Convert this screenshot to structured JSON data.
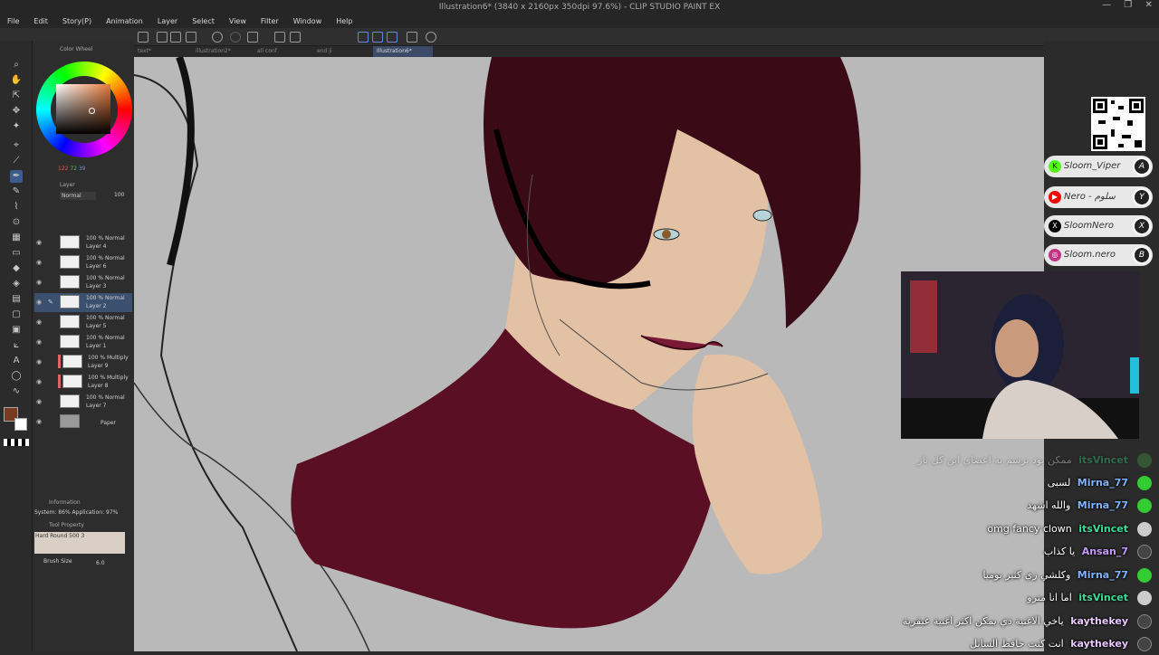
{
  "app": {
    "title": "Illustration6* (3840 x 2160px 350dpi 97.6%) - CLIP STUDIO PAINT EX",
    "window_controls": [
      "—",
      "❐",
      "✕"
    ]
  },
  "menu": [
    "File",
    "Edit",
    "Story(P)",
    "Animation",
    "Layer",
    "Select",
    "View",
    "Filter",
    "Window",
    "Help"
  ],
  "tabs": [
    {
      "label": "text*"
    },
    {
      "label": "illustration2*"
    },
    {
      "label": "all conf"
    },
    {
      "label": "end ji"
    },
    {
      "label": "Illustration6*",
      "active": true
    }
  ],
  "color_panel": {
    "title": "Color Wheel",
    "hsv": [
      "122",
      "72",
      "39"
    ],
    "accent": "#e8793a"
  },
  "layer_panel": {
    "title": "Layer",
    "opacity": "100",
    "blend_mode": "Normal",
    "layers": [
      {
        "mode": "100 % Normal",
        "name": "Layer 4",
        "selected": false
      },
      {
        "mode": "100 % Normal",
        "name": "Layer 6",
        "selected": false
      },
      {
        "mode": "100 % Normal",
        "name": "Layer 3",
        "selected": false
      },
      {
        "mode": "100 % Normal",
        "name": "Layer 2",
        "selected": true
      },
      {
        "mode": "100 % Normal",
        "name": "Layer 5",
        "selected": false
      },
      {
        "mode": "100 % Normal",
        "name": "Layer 1",
        "selected": false
      },
      {
        "mode": "100 % Multiply",
        "name": "Layer 9",
        "selected": false
      },
      {
        "mode": "100 % Multiply",
        "name": "Layer 8",
        "selected": false
      },
      {
        "mode": "100 % Normal",
        "name": "Layer 7",
        "selected": false
      },
      {
        "mode": "",
        "name": "Paper",
        "selected": false
      }
    ]
  },
  "info_panel": {
    "title": "Information",
    "system": "System: 86%  Application: 97%"
  },
  "tool_property": {
    "title": "Tool Property",
    "brush": "Hard Round 500 3",
    "size_label": "Brush Size",
    "size_value": "6.0"
  },
  "overlay": {
    "socials": [
      {
        "icon": "K",
        "handle": "Sloom_Viper",
        "avatar": "A",
        "color": "#53fc18"
      },
      {
        "icon": "▶",
        "handle": "Nero - سلوم",
        "avatar": "Y",
        "color": "#ff0000"
      },
      {
        "icon": "X",
        "handle": "SloomNero",
        "avatar": "X",
        "color": "#000000"
      },
      {
        "icon": "◎",
        "handle": "Sloom.nero",
        "avatar": "B",
        "color": "#c13584"
      }
    ],
    "chat": [
      {
        "user": "itsVincet",
        "message": "ممکن بود برسم به اعضای این کل باز",
        "color": "#3ddc97",
        "faded": true
      },
      {
        "user": "Mirna_77",
        "message": "لسبی",
        "color": "#7fb2ff"
      },
      {
        "user": "Mirna_77",
        "message": "والله اشهد",
        "color": "#7fb2ff"
      },
      {
        "user": "itsVincet",
        "message": "omg fancy clown",
        "color": "#3ddc97"
      },
      {
        "user": "Ansan_7",
        "message": "يا كذاب",
        "color": "#c59bff"
      },
      {
        "user": "Mirna_77",
        "message": "وكلشي زي كثير بوميا",
        "color": "#7fb2ff"
      },
      {
        "user": "itsVincet",
        "message": "اما انا مترو",
        "color": "#3ddc97"
      },
      {
        "user": "kaythekey",
        "message": "ياخي الاغنية ذي يمكن اكثر اغنية عبقرية",
        "color": "#e9c8ff"
      },
      {
        "user": "kaythekey",
        "message": "انت كنت حافظ السابل",
        "color": "#e9c8ff"
      }
    ]
  }
}
